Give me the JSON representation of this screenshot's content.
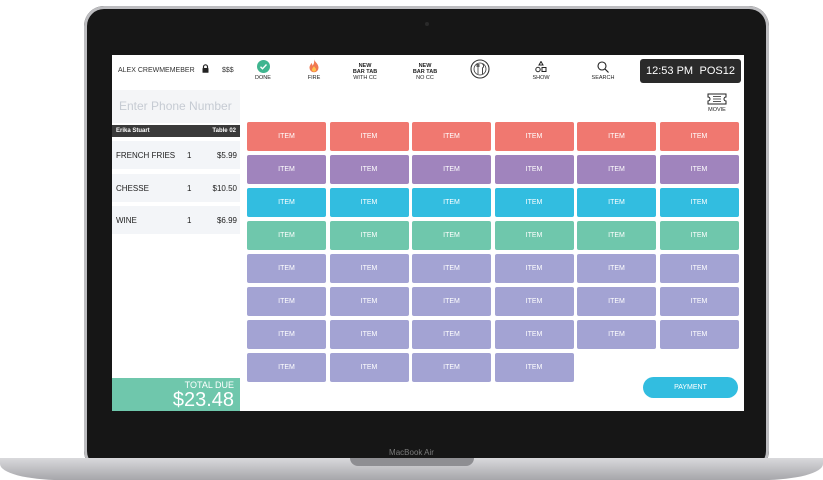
{
  "device": {
    "brand_label": "MacBook Air"
  },
  "header": {
    "user_name": "ALEX CREWMEMEBER",
    "currency_label": "$$$",
    "tools": [
      {
        "icon": "check-circle-icon",
        "line1": "DONE",
        "line2": "",
        "line3": ""
      },
      {
        "icon": "fire-icon",
        "line1": "FIRE",
        "line2": "",
        "line3": ""
      },
      {
        "icon": "",
        "line1": "NEW",
        "line2": "BAR TAB",
        "line3": "WITH CC"
      },
      {
        "icon": "",
        "line1": "NEW",
        "line2": "BAR TAB",
        "line3": "NO CC"
      },
      {
        "icon": "utensils-icon",
        "line1": "",
        "line2": "",
        "line3": ""
      },
      {
        "icon": "shapes-icon",
        "line1": "SHOW",
        "line2": "",
        "line3": ""
      },
      {
        "icon": "search-icon",
        "line1": "SEARCH",
        "line2": "",
        "line3": ""
      }
    ],
    "time": "12:53 PM",
    "terminal": "POS12"
  },
  "phone": {
    "placeholder": "Enter Phone Number"
  },
  "order": {
    "customer": "Erika Stuart",
    "table": "Table 02",
    "items": [
      {
        "name": "FRENCH FRIES",
        "qty": "1",
        "price": "$5.99"
      },
      {
        "name": "CHESSE",
        "qty": "1",
        "price": "$10.50"
      },
      {
        "name": "WINE",
        "qty": "1",
        "price": "$6.99"
      }
    ]
  },
  "total": {
    "label": "TOTAL DUE",
    "amount": "$23.48"
  },
  "category": {
    "icon": "ticket-icon",
    "label": "MOVIE"
  },
  "menu": {
    "item_label": "ITEM",
    "colors": [
      "#f07870",
      "#a084bd",
      "#32bde0",
      "#6fc7ac",
      "#a3a3d3",
      "#a3a3d3",
      "#a3a3d3",
      "#a3a3d3"
    ],
    "row_counts": [
      6,
      6,
      6,
      6,
      6,
      6,
      6,
      4
    ]
  },
  "payment": {
    "label": "PAYMENT"
  }
}
